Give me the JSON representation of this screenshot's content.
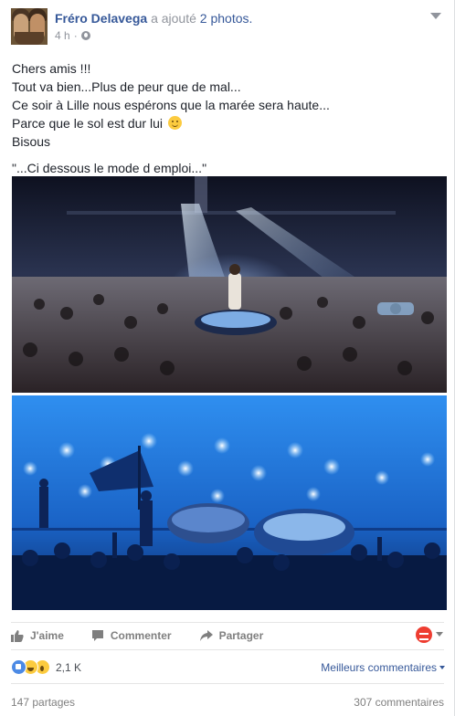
{
  "post": {
    "author": "Fréro Delavega",
    "action": "a ajouté",
    "photo_count": "2 photos.",
    "time": "4 h",
    "text_lines": [
      "Chers amis !!!",
      "Tout va bien...Plus de peur que de mal...",
      "Ce soir à Lille nous espérons que la marée sera haute...",
      "Parce que le sol est dur lui",
      "Bisous"
    ],
    "quote": "\"...Ci dessous le mode d emploi...\""
  },
  "actions": {
    "like": "J'aime",
    "comment": "Commenter",
    "share": "Partager"
  },
  "reactions": {
    "count": "2,1 K",
    "sort_label": "Meilleurs commentaires"
  },
  "stats": {
    "shares": "147 partages",
    "comments": "307 commentaires"
  },
  "colors": {
    "link": "#365899",
    "muted": "#90949c",
    "like_blue": "#4c8ae5",
    "reader_red": "#ee3d31"
  }
}
